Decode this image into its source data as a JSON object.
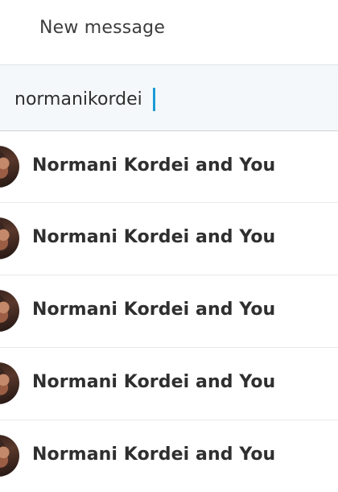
{
  "header": {
    "title": "New message"
  },
  "search": {
    "value": "normanikordei"
  },
  "results": [
    {
      "label": "Normani Kordei and You",
      "avatar": "avatar-photo"
    },
    {
      "label": "Normani Kordei and You",
      "avatar": "avatar-photo"
    },
    {
      "label": "Normani Kordei and You",
      "avatar": "avatar-photo"
    },
    {
      "label": "Normani Kordei and You",
      "avatar": "avatar-photo"
    },
    {
      "label": "Normani Kordei and You",
      "avatar": "avatar-photo"
    }
  ],
  "colors": {
    "caret": "#1d9bd6",
    "search_bg": "#f5f8fa"
  }
}
